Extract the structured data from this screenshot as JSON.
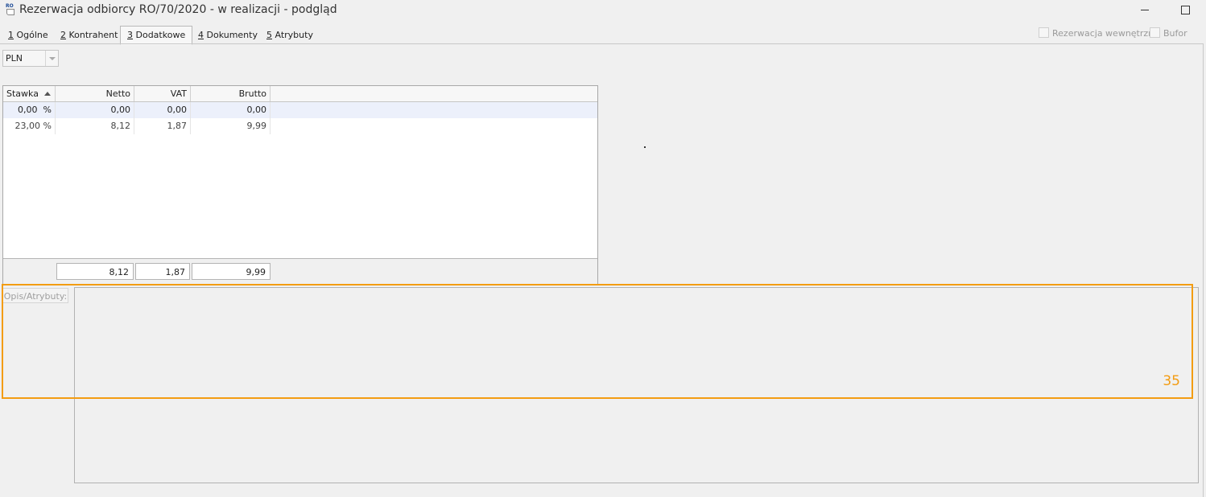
{
  "window": {
    "icon_text": "RO",
    "title": "Rezerwacja odbiorcy RO/70/2020 - w realizacji - podgląd"
  },
  "tabs": [
    {
      "key": "1",
      "label": "Ogólne"
    },
    {
      "key": "2",
      "label": "Kontrahent"
    },
    {
      "key": "3",
      "label": "Dodatkowe"
    },
    {
      "key": "4",
      "label": "Dokumenty"
    },
    {
      "key": "5",
      "label": "Atrybuty"
    }
  ],
  "active_tab": "Dodatkowe",
  "checkboxes": {
    "rezerwacja_wewnetrzna": {
      "label": "Rezerwacja wewnętrzna",
      "checked": false
    },
    "bufor": {
      "label": "Bufor",
      "checked": false
    }
  },
  "currency": {
    "value": "PLN"
  },
  "vat_table": {
    "columns": [
      "Stawka",
      "Netto",
      "VAT",
      "Brutto"
    ],
    "rows": [
      {
        "stawka": "0,00",
        "unit": "%",
        "netto": "0,00",
        "vat": "0,00",
        "brutto": "0,00"
      },
      {
        "stawka": "23,00",
        "unit": "%",
        "netto": "8,12",
        "vat": "1,87",
        "brutto": "9,99"
      }
    ],
    "totals": {
      "netto": "8,12",
      "vat": "1,87",
      "brutto": "9,99"
    }
  },
  "opis": {
    "label": "Opis/Atrybuty:",
    "value": ""
  },
  "annotation": {
    "number": "35",
    "color": "#f39c12"
  }
}
